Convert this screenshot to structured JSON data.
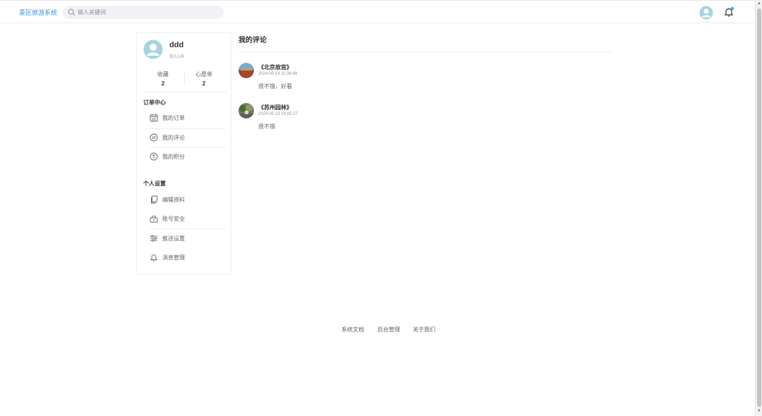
{
  "header": {
    "brand": "景区旅游系统",
    "search_placeholder": "输入关键词",
    "icons": [
      "search-icon",
      "user-avatar-icon",
      "bell-icon"
    ],
    "notification_dot": true
  },
  "profile": {
    "username": "ddd",
    "joined": "加入1天",
    "stats": [
      {
        "label": "收藏",
        "value": "2"
      },
      {
        "label": "心愿单",
        "value": "2"
      }
    ]
  },
  "sidebar": {
    "sections": [
      {
        "title": "订单中心",
        "items": [
          {
            "label": "我的订单",
            "icon": "calendar-icon"
          },
          {
            "label": "我的评论",
            "icon": "comment-icon"
          },
          {
            "label": "我的积分",
            "icon": "points-icon"
          }
        ]
      },
      {
        "title": "个人设置",
        "items": [
          {
            "label": "编辑资料",
            "icon": "copy-document-icon"
          },
          {
            "label": "账号安全",
            "icon": "lock-icon"
          },
          {
            "label": "推送设置",
            "icon": "sliders-icon"
          },
          {
            "label": "消息管理",
            "icon": "bell-icon"
          }
        ]
      }
    ]
  },
  "main": {
    "title": "我的评论",
    "comments": [
      {
        "title": "《北京故宫》",
        "time": "2024-05-14 11:38:49",
        "text": "很不错，好看"
      },
      {
        "title": "《苏州园林》",
        "time": "2024-05-13 14:05:27",
        "text": "很不错"
      }
    ]
  },
  "footer": {
    "links": [
      "系统文档",
      "后台管理",
      "关于我们"
    ]
  },
  "colors": {
    "brand": "#3a8ee6",
    "avatar_bg": "#a7d4dd",
    "notification_dot": "#409eff"
  }
}
